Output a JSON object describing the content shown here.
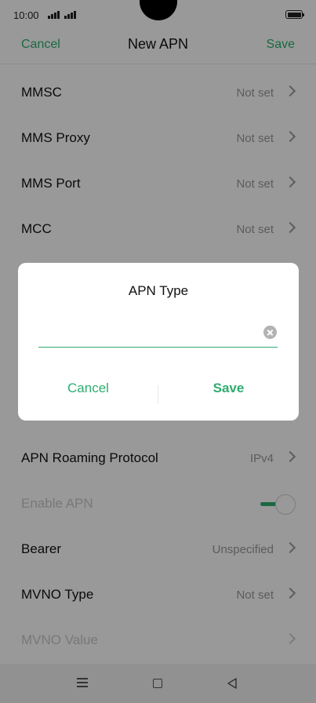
{
  "status_bar": {
    "time": "10:00"
  },
  "header": {
    "cancel_label": "Cancel",
    "title": "New APN",
    "save_label": "Save"
  },
  "settings": [
    {
      "label": "MMSC",
      "value": "Not set"
    },
    {
      "label": "MMS Proxy",
      "value": "Not set"
    },
    {
      "label": "MMS Port",
      "value": "Not set"
    },
    {
      "label": "MCC",
      "value": "Not set"
    },
    {
      "label": "APN Roaming Protocol",
      "value": "IPv4"
    },
    {
      "label": "Enable APN",
      "enabled": true
    },
    {
      "label": "Bearer",
      "value": "Unspecified"
    },
    {
      "label": "MVNO Type",
      "value": "Not set"
    },
    {
      "label": "MVNO Value",
      "value": ""
    }
  ],
  "dialog": {
    "title": "APN Type",
    "input_value": "",
    "cancel_label": "Cancel",
    "save_label": "Save"
  },
  "colors": {
    "accent": "#2ead6f",
    "overlay": "rgba(0,0,0,0.40)"
  },
  "icons": [
    "signal-icon",
    "battery-icon",
    "chevron-right-icon",
    "clear-icon",
    "menu-icon",
    "home-icon",
    "back-icon"
  ]
}
